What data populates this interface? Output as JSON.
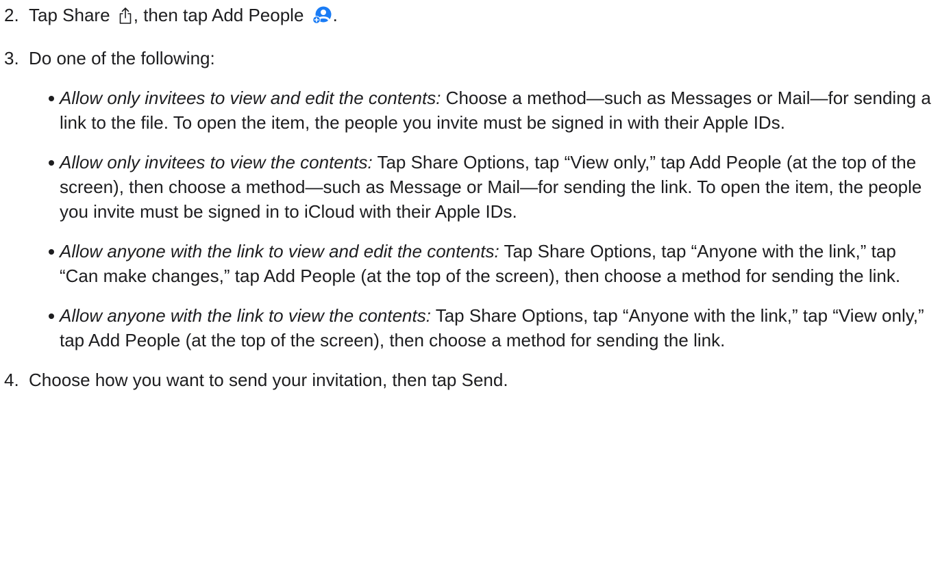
{
  "steps": [
    {
      "number": "2.",
      "before_share": "Tap Share",
      "between_icons": ", then tap Add People",
      "after_icon": "."
    },
    {
      "number": "3.",
      "text": "Do one of the following:",
      "bullets": [
        {
          "lead": "Allow only invitees to view and edit the contents:",
          "text": " Choose a method—such as Messages or Mail—for sending a link to the file. To open the item, the people you invite must be signed in with their Apple IDs."
        },
        {
          "lead": "Allow only invitees to view the contents:",
          "text": " Tap Share Options, tap “View only,” tap Add People (at the top of the screen), then choose a method—such as Message or Mail—for sending the link. To open the item, the people you invite must be signed in to iCloud with their Apple IDs."
        },
        {
          "lead": "Allow anyone with the link to view and edit the contents:",
          "text": " Tap Share Options, tap “Anyone with the link,” tap “Can make changes,” tap Add People (at the top of the screen), then choose a method for sending the link."
        },
        {
          "lead": "Allow anyone with the link to view the contents:",
          "text": " Tap Share Options, tap “Anyone with the link,” tap “View only,” tap Add People (at the top of the screen), then choose a method for sending the link."
        }
      ]
    },
    {
      "number": "4.",
      "text": "Choose how you want to send your invitation, then tap Send."
    }
  ],
  "icons": {
    "share": "share-icon",
    "add_people": "add-people-icon"
  },
  "colors": {
    "text": "#1d1d1f",
    "icon_accent": "#1a7cf5"
  }
}
